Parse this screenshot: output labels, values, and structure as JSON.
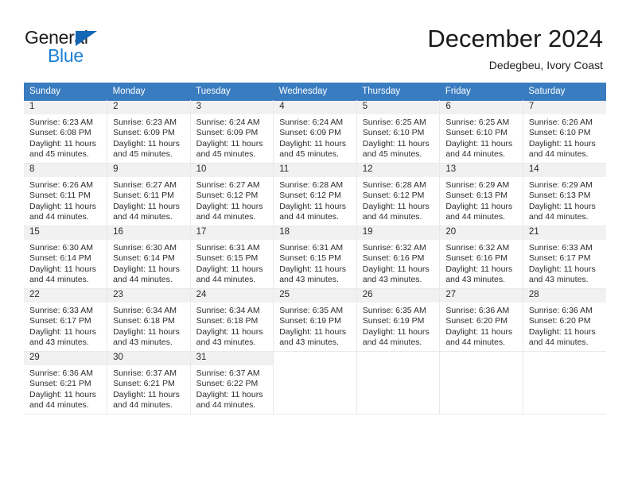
{
  "brand": {
    "name_top": "General",
    "name_bottom": "Blue",
    "triangle_color": "#1567b5",
    "blue_color": "#1c7fd4"
  },
  "header": {
    "title": "December 2024",
    "subtitle": "Dedegbeu, Ivory Coast"
  },
  "theme": {
    "header_bg": "#3a7cc0",
    "daynum_bg": "#f1f1f1",
    "grid_line": "#e9e9e9"
  },
  "weekday_headers": [
    "Sunday",
    "Monday",
    "Tuesday",
    "Wednesday",
    "Thursday",
    "Friday",
    "Saturday"
  ],
  "weeks": [
    [
      {
        "day": "1",
        "sunrise": "Sunrise: 6:23 AM",
        "sunset": "Sunset: 6:08 PM",
        "daylight_1": "Daylight: 11 hours",
        "daylight_2": "and 45 minutes."
      },
      {
        "day": "2",
        "sunrise": "Sunrise: 6:23 AM",
        "sunset": "Sunset: 6:09 PM",
        "daylight_1": "Daylight: 11 hours",
        "daylight_2": "and 45 minutes."
      },
      {
        "day": "3",
        "sunrise": "Sunrise: 6:24 AM",
        "sunset": "Sunset: 6:09 PM",
        "daylight_1": "Daylight: 11 hours",
        "daylight_2": "and 45 minutes."
      },
      {
        "day": "4",
        "sunrise": "Sunrise: 6:24 AM",
        "sunset": "Sunset: 6:09 PM",
        "daylight_1": "Daylight: 11 hours",
        "daylight_2": "and 45 minutes."
      },
      {
        "day": "5",
        "sunrise": "Sunrise: 6:25 AM",
        "sunset": "Sunset: 6:10 PM",
        "daylight_1": "Daylight: 11 hours",
        "daylight_2": "and 45 minutes."
      },
      {
        "day": "6",
        "sunrise": "Sunrise: 6:25 AM",
        "sunset": "Sunset: 6:10 PM",
        "daylight_1": "Daylight: 11 hours",
        "daylight_2": "and 44 minutes."
      },
      {
        "day": "7",
        "sunrise": "Sunrise: 6:26 AM",
        "sunset": "Sunset: 6:10 PM",
        "daylight_1": "Daylight: 11 hours",
        "daylight_2": "and 44 minutes."
      }
    ],
    [
      {
        "day": "8",
        "sunrise": "Sunrise: 6:26 AM",
        "sunset": "Sunset: 6:11 PM",
        "daylight_1": "Daylight: 11 hours",
        "daylight_2": "and 44 minutes."
      },
      {
        "day": "9",
        "sunrise": "Sunrise: 6:27 AM",
        "sunset": "Sunset: 6:11 PM",
        "daylight_1": "Daylight: 11 hours",
        "daylight_2": "and 44 minutes."
      },
      {
        "day": "10",
        "sunrise": "Sunrise: 6:27 AM",
        "sunset": "Sunset: 6:12 PM",
        "daylight_1": "Daylight: 11 hours",
        "daylight_2": "and 44 minutes."
      },
      {
        "day": "11",
        "sunrise": "Sunrise: 6:28 AM",
        "sunset": "Sunset: 6:12 PM",
        "daylight_1": "Daylight: 11 hours",
        "daylight_2": "and 44 minutes."
      },
      {
        "day": "12",
        "sunrise": "Sunrise: 6:28 AM",
        "sunset": "Sunset: 6:12 PM",
        "daylight_1": "Daylight: 11 hours",
        "daylight_2": "and 44 minutes."
      },
      {
        "day": "13",
        "sunrise": "Sunrise: 6:29 AM",
        "sunset": "Sunset: 6:13 PM",
        "daylight_1": "Daylight: 11 hours",
        "daylight_2": "and 44 minutes."
      },
      {
        "day": "14",
        "sunrise": "Sunrise: 6:29 AM",
        "sunset": "Sunset: 6:13 PM",
        "daylight_1": "Daylight: 11 hours",
        "daylight_2": "and 44 minutes."
      }
    ],
    [
      {
        "day": "15",
        "sunrise": "Sunrise: 6:30 AM",
        "sunset": "Sunset: 6:14 PM",
        "daylight_1": "Daylight: 11 hours",
        "daylight_2": "and 44 minutes."
      },
      {
        "day": "16",
        "sunrise": "Sunrise: 6:30 AM",
        "sunset": "Sunset: 6:14 PM",
        "daylight_1": "Daylight: 11 hours",
        "daylight_2": "and 44 minutes."
      },
      {
        "day": "17",
        "sunrise": "Sunrise: 6:31 AM",
        "sunset": "Sunset: 6:15 PM",
        "daylight_1": "Daylight: 11 hours",
        "daylight_2": "and 44 minutes."
      },
      {
        "day": "18",
        "sunrise": "Sunrise: 6:31 AM",
        "sunset": "Sunset: 6:15 PM",
        "daylight_1": "Daylight: 11 hours",
        "daylight_2": "and 43 minutes."
      },
      {
        "day": "19",
        "sunrise": "Sunrise: 6:32 AM",
        "sunset": "Sunset: 6:16 PM",
        "daylight_1": "Daylight: 11 hours",
        "daylight_2": "and 43 minutes."
      },
      {
        "day": "20",
        "sunrise": "Sunrise: 6:32 AM",
        "sunset": "Sunset: 6:16 PM",
        "daylight_1": "Daylight: 11 hours",
        "daylight_2": "and 43 minutes."
      },
      {
        "day": "21",
        "sunrise": "Sunrise: 6:33 AM",
        "sunset": "Sunset: 6:17 PM",
        "daylight_1": "Daylight: 11 hours",
        "daylight_2": "and 43 minutes."
      }
    ],
    [
      {
        "day": "22",
        "sunrise": "Sunrise: 6:33 AM",
        "sunset": "Sunset: 6:17 PM",
        "daylight_1": "Daylight: 11 hours",
        "daylight_2": "and 43 minutes."
      },
      {
        "day": "23",
        "sunrise": "Sunrise: 6:34 AM",
        "sunset": "Sunset: 6:18 PM",
        "daylight_1": "Daylight: 11 hours",
        "daylight_2": "and 43 minutes."
      },
      {
        "day": "24",
        "sunrise": "Sunrise: 6:34 AM",
        "sunset": "Sunset: 6:18 PM",
        "daylight_1": "Daylight: 11 hours",
        "daylight_2": "and 43 minutes."
      },
      {
        "day": "25",
        "sunrise": "Sunrise: 6:35 AM",
        "sunset": "Sunset: 6:19 PM",
        "daylight_1": "Daylight: 11 hours",
        "daylight_2": "and 43 minutes."
      },
      {
        "day": "26",
        "sunrise": "Sunrise: 6:35 AM",
        "sunset": "Sunset: 6:19 PM",
        "daylight_1": "Daylight: 11 hours",
        "daylight_2": "and 44 minutes."
      },
      {
        "day": "27",
        "sunrise": "Sunrise: 6:36 AM",
        "sunset": "Sunset: 6:20 PM",
        "daylight_1": "Daylight: 11 hours",
        "daylight_2": "and 44 minutes."
      },
      {
        "day": "28",
        "sunrise": "Sunrise: 6:36 AM",
        "sunset": "Sunset: 6:20 PM",
        "daylight_1": "Daylight: 11 hours",
        "daylight_2": "and 44 minutes."
      }
    ],
    [
      {
        "day": "29",
        "sunrise": "Sunrise: 6:36 AM",
        "sunset": "Sunset: 6:21 PM",
        "daylight_1": "Daylight: 11 hours",
        "daylight_2": "and 44 minutes."
      },
      {
        "day": "30",
        "sunrise": "Sunrise: 6:37 AM",
        "sunset": "Sunset: 6:21 PM",
        "daylight_1": "Daylight: 11 hours",
        "daylight_2": "and 44 minutes."
      },
      {
        "day": "31",
        "sunrise": "Sunrise: 6:37 AM",
        "sunset": "Sunset: 6:22 PM",
        "daylight_1": "Daylight: 11 hours",
        "daylight_2": "and 44 minutes."
      },
      {
        "day": "",
        "sunrise": "",
        "sunset": "",
        "daylight_1": "",
        "daylight_2": ""
      },
      {
        "day": "",
        "sunrise": "",
        "sunset": "",
        "daylight_1": "",
        "daylight_2": ""
      },
      {
        "day": "",
        "sunrise": "",
        "sunset": "",
        "daylight_1": "",
        "daylight_2": ""
      },
      {
        "day": "",
        "sunrise": "",
        "sunset": "",
        "daylight_1": "",
        "daylight_2": ""
      }
    ]
  ]
}
